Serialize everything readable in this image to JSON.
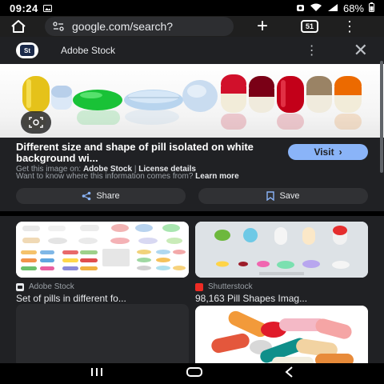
{
  "status_bar": {
    "time": "09:24",
    "battery": "68%"
  },
  "browser": {
    "url": "google.com/search?",
    "tab_count": "51"
  },
  "panel": {
    "source_logo_text": "St",
    "source_name": "Adobe Stock",
    "title": "Different size and shape of pill isolated on white background wi...",
    "visit_label": "Visit",
    "get_image_prefix": "Get this image on:",
    "get_image_source": "Adobe Stock",
    "license_label": "License details",
    "want_to_know": "Want to know where this information comes from?",
    "learn_more": "Learn more",
    "share_label": "Share",
    "save_label": "Save"
  },
  "results": [
    {
      "source": "Adobe Stock",
      "caption": "Set of pills in different fo..."
    },
    {
      "source": "Shutterstock",
      "caption": "98,163 Pill Shapes Imag..."
    }
  ],
  "colors": {
    "accent": "#8ab4f8",
    "panel_bg": "#202124",
    "button_bg": "#303134"
  }
}
